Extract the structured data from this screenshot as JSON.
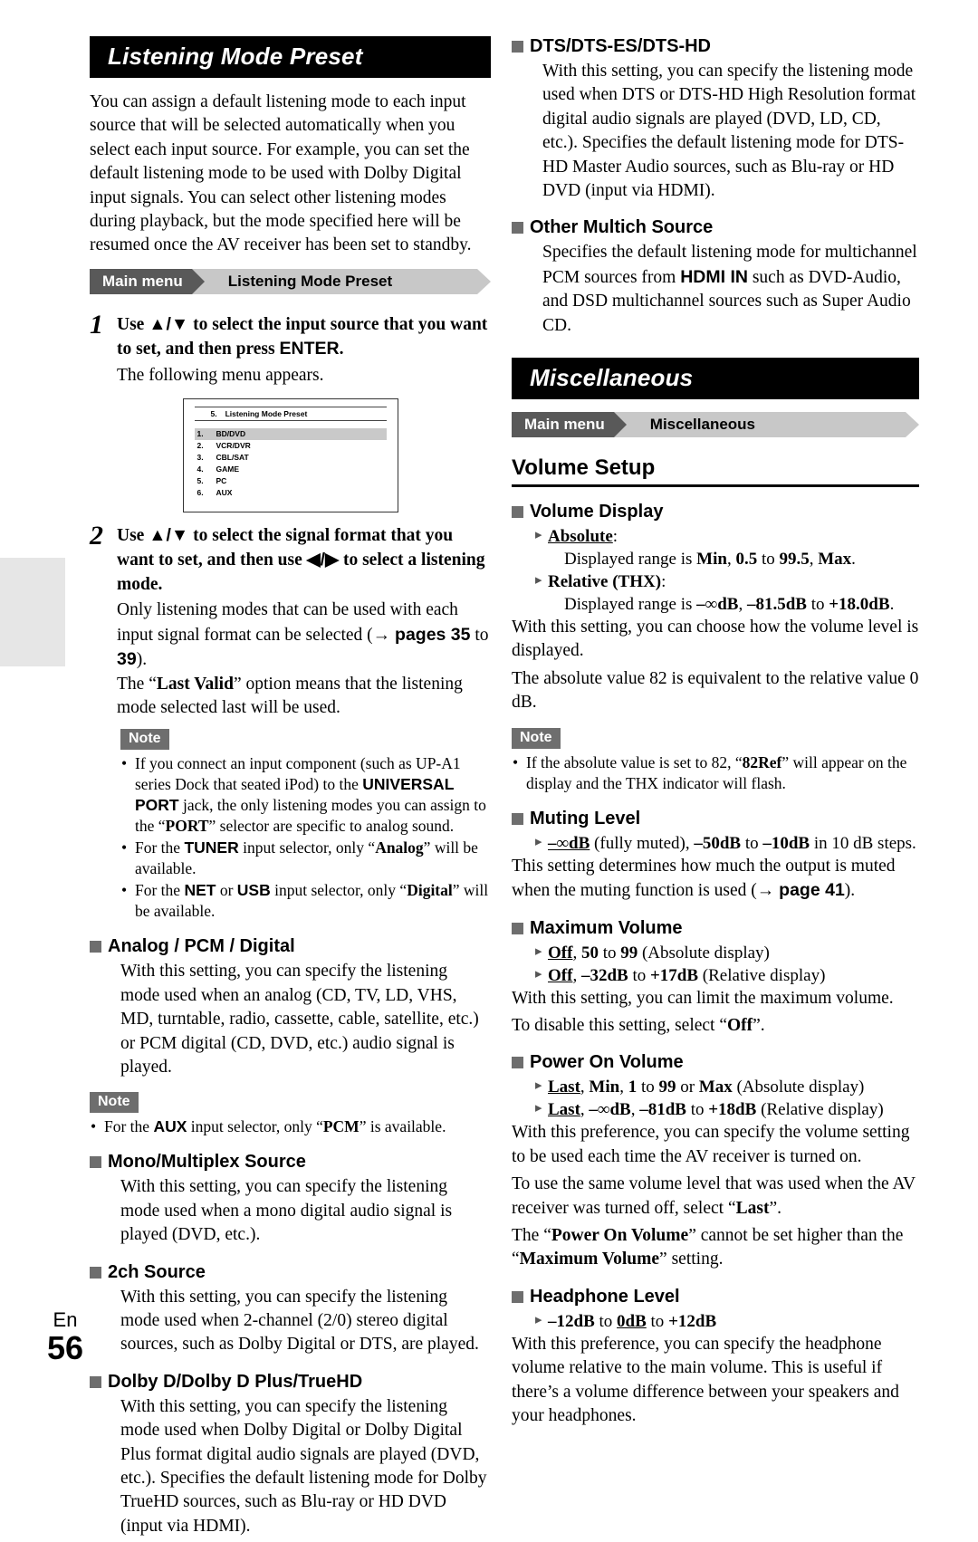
{
  "page": {
    "lang_label": "En",
    "number": "56"
  },
  "left_column": {
    "banner_title": "Listening Mode Preset",
    "intro": "You can assign a default listening mode to each input source that will be selected automatically when you select each input source. For example, you can set the default listening mode to be used with Dolby Digital input signals. You can select other listening modes during playback, but the mode specified here will be resumed once the AV receiver has been set to standby.",
    "breadcrumb": {
      "main": "Main menu",
      "sub": "Listening Mode Preset"
    },
    "step1": {
      "number": "1",
      "title_pre": "Use ",
      "title_arrows": "▲/▼",
      "title_mid": " to select the input source that you want to set, and then press ",
      "title_key": "ENTER",
      "title_end": ".",
      "desc": "The following menu appears."
    },
    "osd": {
      "header_index": "5.",
      "header_title": "Listening Mode Preset",
      "rows": [
        {
          "index": "1.",
          "label": "BD/DVD",
          "selected": true
        },
        {
          "index": "2.",
          "label": "VCR/DVR",
          "selected": false
        },
        {
          "index": "3.",
          "label": "CBL/SAT",
          "selected": false
        },
        {
          "index": "4.",
          "label": "GAME",
          "selected": false
        },
        {
          "index": "5.",
          "label": "PC",
          "selected": false
        },
        {
          "index": "6.",
          "label": "AUX",
          "selected": false
        }
      ]
    },
    "step2": {
      "number": "2",
      "title_pre": "Use ",
      "title_ud": "▲/▼",
      "title_mid": " to select the signal format that you want to set, and then use ",
      "title_lr": "◀/▶",
      "title_end": " to select a listening mode.",
      "desc_a": "Only listening modes that can be used with each input signal format can be selected (",
      "desc_arrow": "→",
      "desc_pages": "pages 35",
      "desc_to": " to ",
      "desc_page_end": "39",
      "desc_b": ").",
      "desc_c_pre": "The “",
      "desc_c_bold": "Last Valid",
      "desc_c_post": "” option means that the listening mode selected last will be used."
    },
    "note1": {
      "label": "Note",
      "items": [
        "If you connect an input component (such as UP-A1 series Dock that seated iPod) to the UNIVERSAL PORT jack, the only listening modes you can assign to the “PORT” selector are specific to analog sound.",
        "For the TUNER input selector, only “Analog” will be available.",
        "For the NET or USB input selector, only “Digital” will be available."
      ]
    },
    "sections": [
      {
        "heading": "Analog / PCM / Digital",
        "body": "With this setting, you can specify the listening mode used when an analog (CD, TV, LD, VHS, MD, turntable, radio, cassette, cable, satellite, etc.) or PCM digital (CD, DVD, etc.) audio signal is played."
      },
      {
        "heading": "Mono/Multiplex Source",
        "body": "With this setting, you can specify the listening mode used when a mono digital audio signal is played (DVD, etc.)."
      },
      {
        "heading": "2ch Source",
        "body": "With this setting, you can specify the listening mode used when 2-channel (2/0) stereo digital sources, such as Dolby Digital or DTS, are played."
      },
      {
        "heading": "Dolby D/Dolby D Plus/TrueHD",
        "body": "With this setting, you can specify the listening mode used when Dolby Digital or Dolby Digital Plus format digital audio signals are played (DVD, etc.). Specifies the default listening mode for Dolby TrueHD sources, such as Blu-ray or HD DVD (input via HDMI)."
      }
    ],
    "note2": {
      "label": "Note",
      "items": [
        "For the AUX input selector, only “PCM” is available."
      ]
    }
  },
  "right_column": {
    "dts": {
      "heading": "DTS/DTS-ES/DTS-HD",
      "body": "With this setting, you can specify the listening mode used when DTS or DTS-HD High Resolution format digital audio signals are played (DVD, LD, CD, etc.). Specifies the default listening mode for DTS-HD Master Audio sources, such as Blu-ray or HD DVD (input via HDMI)."
    },
    "other_multich": {
      "heading": "Other Multich Source",
      "body_a": "Specifies the default listening mode for multichannel PCM sources from ",
      "body_key": "HDMI IN",
      "body_b": " such as DVD-Audio, and DSD multichannel sources such as Super Audio CD."
    },
    "banner_title": "Miscellaneous",
    "breadcrumb": {
      "main": "Main menu",
      "sub": "Miscellaneous"
    },
    "section_title": "Volume Setup",
    "volume_display": {
      "heading": "Volume Display",
      "opt1_label": "Absolute",
      "opt1_colon": ":",
      "opt1_detail_pre": "Displayed range is ",
      "opt1_detail_b1": "Min",
      "opt1_detail_mid1": ", ",
      "opt1_detail_b2": "0.5",
      "opt1_detail_mid2": " to ",
      "opt1_detail_b3": "99.5",
      "opt1_detail_mid3": ", ",
      "opt1_detail_b4": "Max",
      "opt1_detail_end": ".",
      "opt2_label": "Relative",
      "opt2_thx": " (THX)",
      "opt2_colon": ":",
      "opt2_detail_pre": "Displayed range is ",
      "opt2_detail_b1": "–∞dB",
      "opt2_detail_mid1": ", ",
      "opt2_detail_b2": "–81.5dB",
      "opt2_detail_mid2": " to ",
      "opt2_detail_b3": "+18.0dB",
      "opt2_detail_end": ".",
      "body1": "With this setting, you can choose how the volume level is displayed.",
      "body2": "The absolute value 82 is equivalent to the relative value 0 dB."
    },
    "note": {
      "label": "Note",
      "items": [
        "If the absolute value is set to 82, “82Ref” will appear on the display and the THX indicator will flash."
      ]
    },
    "muting_level": {
      "heading": "Muting Level",
      "opt_u": "–∞dB",
      "opt_a": " (fully muted), ",
      "opt_b1": "–50dB",
      "opt_mid": " to ",
      "opt_b2": "–10dB",
      "opt_end": " in 10 dB steps.",
      "body_pre": "This setting determines how much the output is muted when the muting function is used (",
      "body_arrow": "→",
      "body_page": "page 41",
      "body_end": ")."
    },
    "maximum_volume": {
      "heading": "Maximum Volume",
      "opt1_u": "Off",
      "opt1_a": ", ",
      "opt1_b1": "50",
      "opt1_mid": " to ",
      "opt1_b2": "99",
      "opt1_end": " (Absolute display)",
      "opt2_u": "Off",
      "opt2_a": ", ",
      "opt2_b1": "–32dB",
      "opt2_mid": " to ",
      "opt2_b2": "+17dB",
      "opt2_end": " (Relative display)",
      "body1": "With this setting, you can limit the maximum volume.",
      "body2_pre": "To disable this setting, select “",
      "body2_b": "Off",
      "body2_end": "”."
    },
    "power_on_volume": {
      "heading": "Power On Volume",
      "opt1_u": "Last",
      "opt1_a": ", ",
      "opt1_b1": "Min",
      "opt1_a2": ", ",
      "opt1_b2": "1",
      "opt1_mid": " to ",
      "opt1_b3": "99",
      "opt1_or": " or ",
      "opt1_b4": "Max",
      "opt1_end": " (Absolute display)",
      "opt2_u": "Last",
      "opt2_a": ", ",
      "opt2_b1": "–∞dB",
      "opt2_a2": ", ",
      "opt2_b2": "–81dB",
      "opt2_mid": " to ",
      "opt2_b3": "+18dB",
      "opt2_end": " (Relative display)",
      "body1": "With this preference, you can specify the volume setting to be used each time the AV receiver is turned on.",
      "body2_pre": "To use the same volume level that was used when the AV receiver was turned off, select “",
      "body2_b": "Last",
      "body2_end": "”.",
      "body3_pre": "The “",
      "body3_b1": "Power On Volume",
      "body3_mid": "” cannot be set higher than the “",
      "body3_b2": "Maximum Volume",
      "body3_end": "” setting."
    },
    "headphone_level": {
      "heading": "Headphone Level",
      "opt_b1": "–12dB",
      "opt_mid1": " to ",
      "opt_u": "0dB",
      "opt_mid2": " to ",
      "opt_b2": "+12dB",
      "body": "With this preference, you can specify the headphone volume relative to the main volume. This is useful if there’s a volume difference between your speakers and your headphones."
    }
  }
}
